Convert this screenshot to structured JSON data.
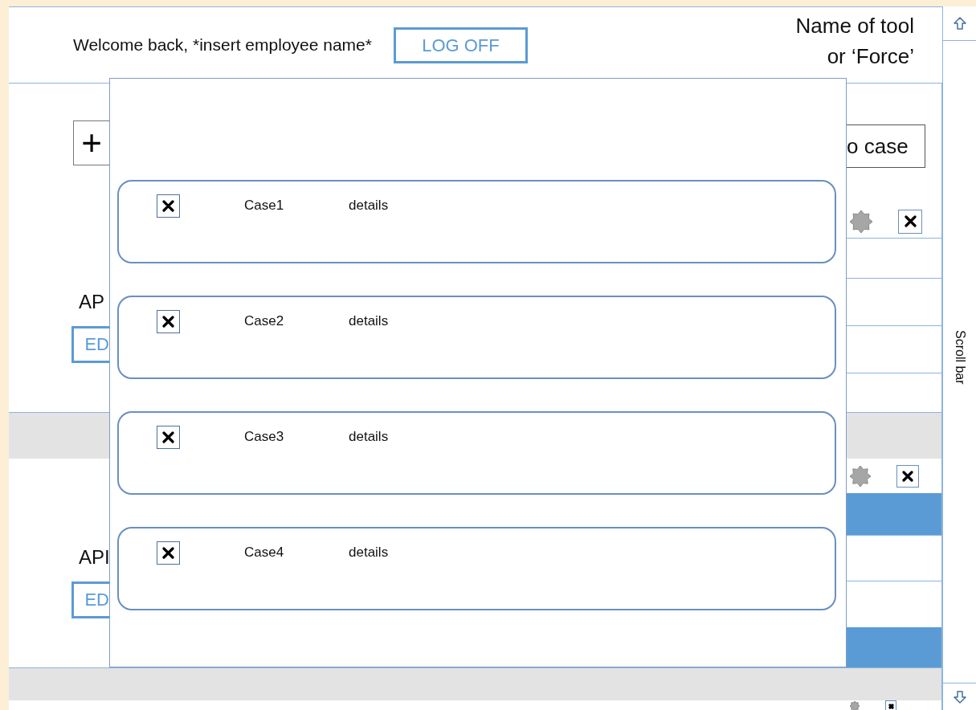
{
  "header": {
    "welcome": "Welcome back,  *insert employee name*",
    "logoff": "LOG OFF",
    "title_lines": [
      "Name of tool",
      "or ‘Force’"
    ]
  },
  "sections": [
    {
      "kind": "actions",
      "plus": "+",
      "button": "o case"
    },
    {
      "kind": "record",
      "label": "AP",
      "button": "ED",
      "rows": [
        {
          "selected": false
        },
        {
          "selected": false
        },
        {
          "selected": false
        },
        {
          "selected": false
        }
      ]
    },
    {
      "kind": "band"
    },
    {
      "kind": "tools"
    },
    {
      "kind": "record",
      "label": "API",
      "button": "ED",
      "rows": [
        {
          "selected": true
        },
        {
          "selected": false
        },
        {
          "selected": false
        },
        {
          "selected": true
        }
      ]
    },
    {
      "kind": "band"
    },
    {
      "kind": "tools"
    }
  ],
  "scrollbar": {
    "label": "Scroll bar"
  },
  "dialog": {
    "cases": [
      {
        "name": "Case1",
        "details": "details"
      },
      {
        "name": "Case2",
        "details": "details"
      },
      {
        "name": "Case3",
        "details": "details"
      },
      {
        "name": "Case4",
        "details": "details"
      }
    ]
  }
}
